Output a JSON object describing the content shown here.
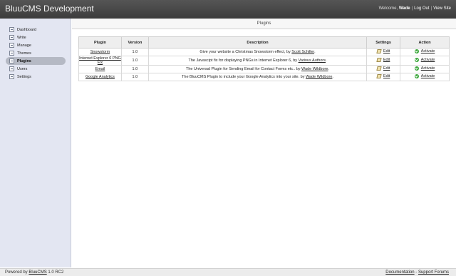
{
  "app": {
    "title": "BluuCMS Development"
  },
  "topnav": {
    "welcome_prefix": "Welcome, ",
    "user": "Wade",
    "logout": "Log Out",
    "view_site": "View Site",
    "separator": "|"
  },
  "sidebar": {
    "items": [
      {
        "label": "Dashboard",
        "icon": "dashboard-icon"
      },
      {
        "label": "Write",
        "icon": "write-icon"
      },
      {
        "label": "Manage",
        "icon": "manage-icon"
      },
      {
        "label": "Themes",
        "icon": "themes-icon"
      },
      {
        "label": "Plugins",
        "icon": "plugins-icon"
      },
      {
        "label": "Users",
        "icon": "users-icon"
      },
      {
        "label": "Settings",
        "icon": "settings-icon"
      }
    ]
  },
  "page": {
    "title": "Plugins"
  },
  "table": {
    "headers": [
      "Plugin",
      "Version",
      "Description",
      "Settings",
      "Action"
    ],
    "rows": [
      {
        "plugin": "Snowstorm",
        "version": "1.0",
        "desc_text": "Give your website a Christmas Snowstorm effect, by ",
        "desc_author": "Scott Schiller",
        "desc_suffix": ".",
        "settings": "Edit",
        "action": "Activate"
      },
      {
        "plugin": "Internet Explorer 6 PNG Fix",
        "version": "1.0",
        "desc_text": "The Javascipt fix for displaying PNGs in Internet Explorer 6, by ",
        "desc_author": "Various Authors",
        "desc_suffix": ".",
        "settings": "Edit",
        "action": "Activate"
      },
      {
        "plugin": "Email",
        "version": "1.0",
        "desc_text": "The Universal Plugin for Sending Email for Contact Forms etc.. by ",
        "desc_author": "Wade Wildbore",
        "desc_suffix": ".",
        "settings": "Edit",
        "action": "Activate"
      },
      {
        "plugin": "Google Analytics",
        "version": "1.0",
        "desc_text": "The BluuCMS Plugin to include your Google Analytics into your site. by ",
        "desc_author": "Wade Wildbore",
        "desc_suffix": ".",
        "settings": "Edit",
        "action": "Activate"
      }
    ]
  },
  "footer": {
    "powered_prefix": "Powered by ",
    "powered_link": "BluuCMS",
    "version": " 1.0 RC2",
    "documentation": "Documentation",
    "dash": "-",
    "support": "Support Forums"
  },
  "colors": {
    "topbar": "#444444",
    "sidebar": "#e3e6f2",
    "active_item": "#b5b9c4"
  }
}
